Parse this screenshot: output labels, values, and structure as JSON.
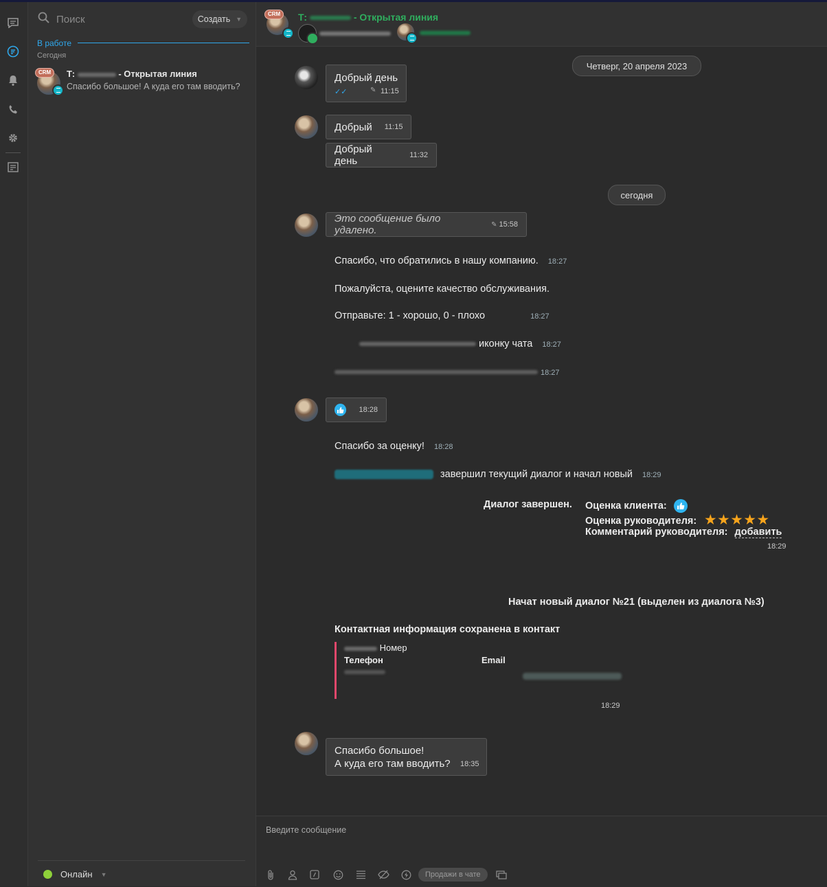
{
  "sidebar": {
    "search_placeholder": "Поиск",
    "create_label": "Создать",
    "section_label": "В работе",
    "today_label": "Сегодня",
    "chat_item": {
      "badge": "CRM",
      "title_prefix": "Т:",
      "title_suffix": "- Открытая линия",
      "preview": "Спасибо большое! А куда его там вводить?"
    },
    "status_label": "Онлайн"
  },
  "header": {
    "badge": "CRM",
    "title_prefix": "Т:",
    "title_suffix": "- Открытая линия"
  },
  "messages": {
    "date1": "Четверг, 20 апреля 2023",
    "m1_text": "Добрый день",
    "m1_time": "11:15",
    "m2_text": "Добрый",
    "m2_time": "11:15",
    "m3_text": "Добрый день",
    "m3_time": "11:32",
    "date2": "сегодня",
    "m4_text": "Это сообщение было удалено.",
    "m4_time": "15:58",
    "s1_text": "Спасибо, что обратились в нашу компанию.",
    "s1_time": "18:27",
    "s2_text": "Пожалуйста, оцените качество обслуживания.",
    "s3_text": "Отправьте: 1 - хорошо, 0 - плохо",
    "s3_time": "18:27",
    "s4_text": "иконку чата",
    "s4_time": "18:27",
    "s5_time": "18:27",
    "m5_time": "18:28",
    "s6_text": "Спасибо за оценку!",
    "s6_time": "18:28",
    "s7_text": "завершил текущий диалог и начал новый",
    "s7_time": "18:29",
    "finished_label": "Диалог завершен.",
    "client_rating_label": "Оценка клиента:",
    "manager_rating_label": "Оценка руководителя:",
    "manager_rating_stars": 5,
    "manager_comment_label": "Комментарий руководителя:",
    "manager_comment_link": "добавить",
    "finished_time": "18:29",
    "new_dialog": "Начат новый диалог №21 (выделен из диалога №3)",
    "contact_saved": "Контактная информация сохранена в контакт",
    "contact_number_label": "Номер",
    "contact_phone_label": "Телефон",
    "contact_email_label": "Email",
    "contact_time": "18:29",
    "m6_line1": "Спасибо большое!",
    "m6_line2": "А куда его там вводить?",
    "m6_time": "18:35"
  },
  "input": {
    "placeholder": "Введите сообщение",
    "sales_label": "Продажи в чате"
  },
  "colors": {
    "accent_blue": "#2fa8ec",
    "header_green": "#2fae5e",
    "online_green": "#8ed03a",
    "star_orange": "#f7a41c",
    "contact_bar": "#e0476b"
  }
}
